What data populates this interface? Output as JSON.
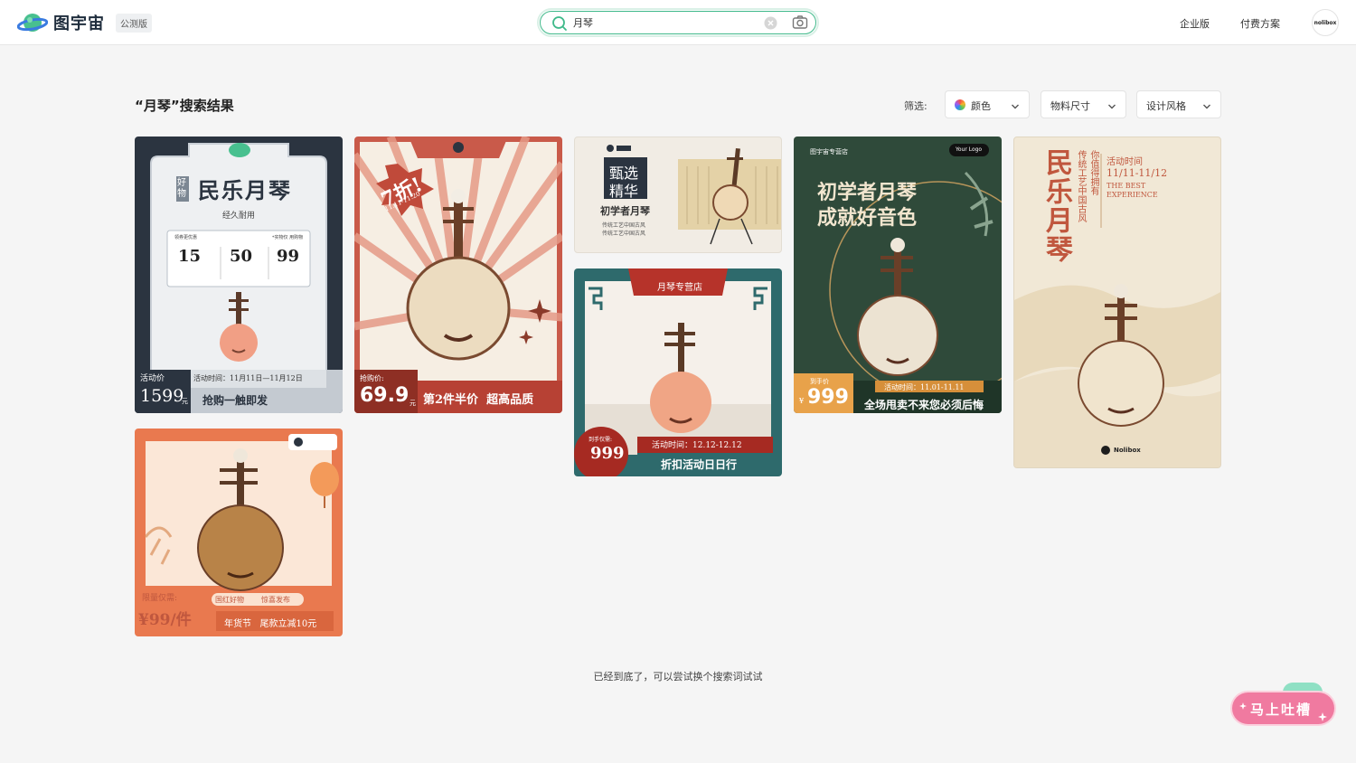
{
  "header": {
    "brand": "图宇宙",
    "beta_badge": "公测版",
    "search_value": "月琴",
    "nav_enterprise": "企业版",
    "nav_pricing": "付费方案",
    "avatar_text": "nolibox"
  },
  "results": {
    "title": "“月琴”搜索结果",
    "filter_label": "筛选:",
    "filters": [
      "颜色",
      "物料尺寸",
      "设计风格"
    ],
    "end_note": "已经到底了，可以尝试换个搜索词试试"
  },
  "feedback_label": "马上吐槽",
  "cards": {
    "c1": {
      "badge": "好物",
      "title": "民乐月琴",
      "subtitle": "经久耐用",
      "coupon_head_left": "领券更优惠",
      "coupon_head_right": "*实物仅 用购物",
      "coupons": [
        "15",
        "50",
        "99"
      ],
      "price_label": "活动价",
      "price": "1599",
      "price_unit": "元",
      "date": "活动时间：11月11日—11月12日",
      "slogan": "抢购一触即发"
    },
    "c2": {
      "burst": "7折!",
      "burst_date": "11.11-11.20",
      "price_label": "抢购价:",
      "price": "69.9",
      "price_unit": "元",
      "slogan": "第2件半价  超高品质"
    },
    "c3": {
      "tag1": "甄选",
      "tag2": "精华",
      "title": "初学者月琴",
      "line1": "传统工艺中国古风",
      "line2": "传统工艺中国古风"
    },
    "c4": {
      "banner": "月琴专营店",
      "price_label": "到手仅需:",
      "price": "999",
      "date": "活动时间：12.12-12.12",
      "slogan": "折扣活动日日行"
    },
    "c5": {
      "store": "图宇宙专营店",
      "logo": "Your Logo",
      "line1": "初学者月琴",
      "line2": "成就好音色",
      "price_label": "到手价",
      "price": "999",
      "currency": "¥",
      "date": "活动时间：11.01-11.11",
      "slogan": "全场甩卖不来您必须后悔"
    },
    "c6": {
      "title": "民乐月琴",
      "col1": "传统工艺中国古风",
      "col2": "你值得拥有",
      "event": "活动时间",
      "date": "11/11-11/12",
      "en1": "THE BEST",
      "en2": "EXPERIENCE",
      "brand": "Nolibox"
    },
    "c7": {
      "price_label": "限量仅需:",
      "price": "¥99/件",
      "tag1": "国红好物",
      "tag2": "惊喜发布",
      "line": "年货节   尾款立减10元"
    }
  },
  "colors": {
    "accent": "#3fb98a",
    "feedback": "#f07aa0"
  }
}
